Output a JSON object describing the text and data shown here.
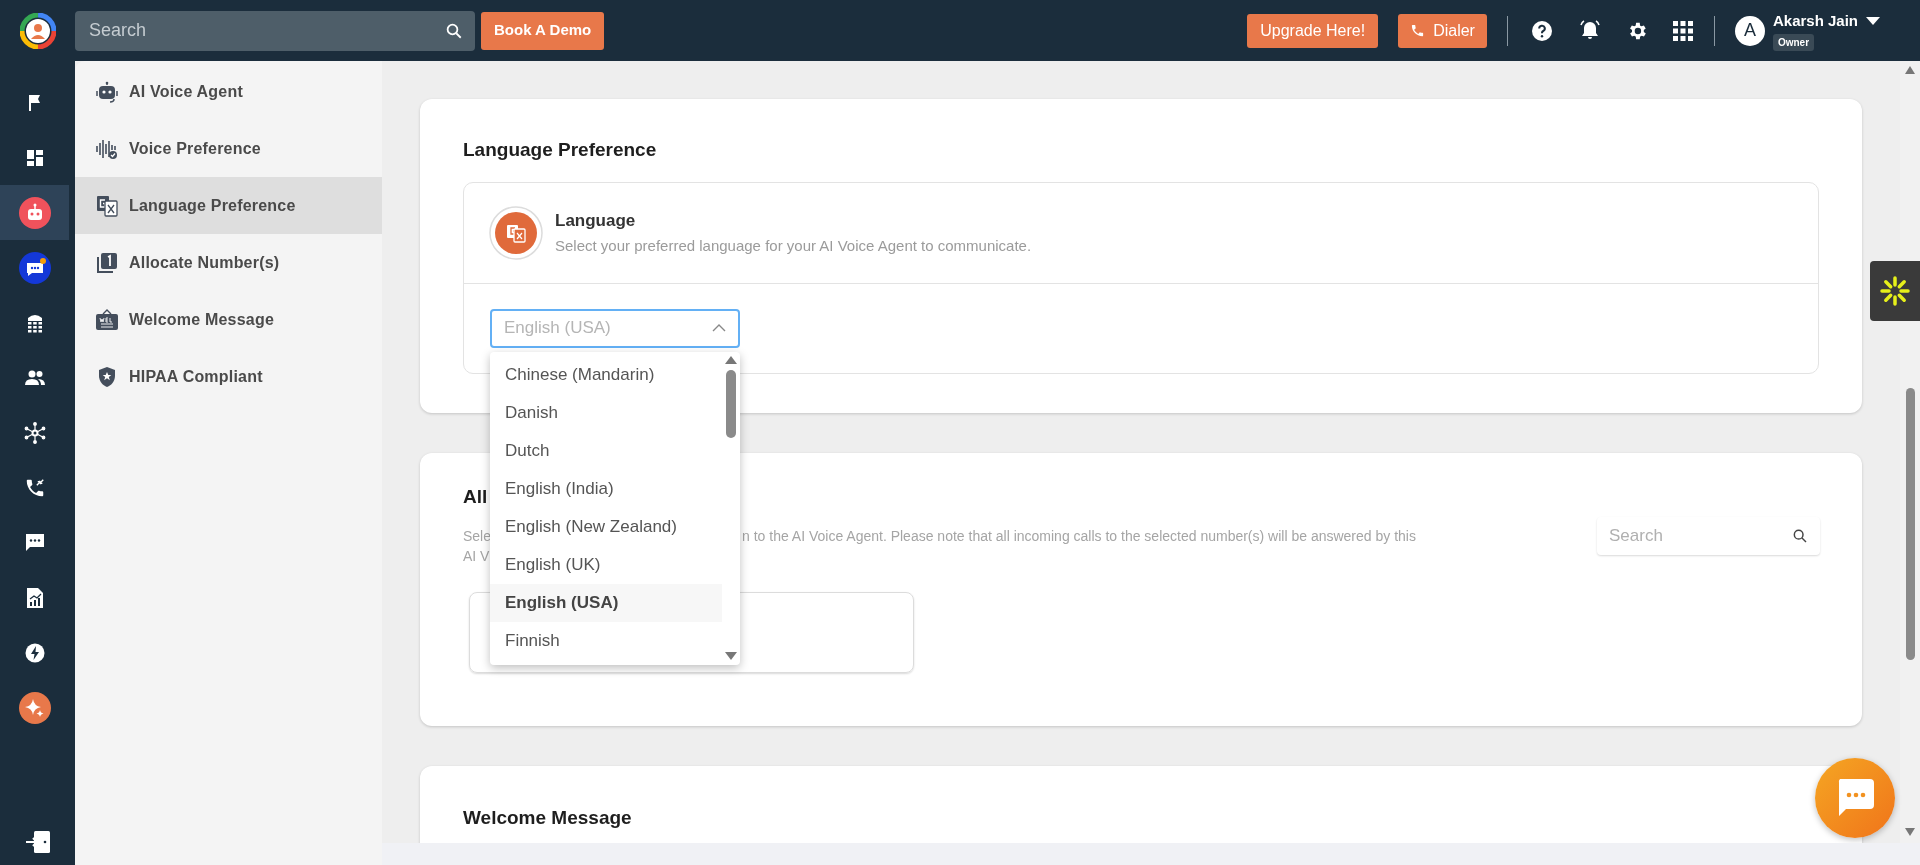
{
  "top_bar": {
    "search": {
      "placeholder": "Search"
    },
    "demo_button": "Book A Demo",
    "upgrade_button": "Upgrade Here!",
    "dialer_button": "Dialer",
    "user": {
      "avatar_letter": "A",
      "name": "Akarsh Jain",
      "role": "Owner"
    }
  },
  "rail": [
    {
      "kind": "flag",
      "selected": false
    },
    {
      "kind": "dashboard",
      "selected": false
    },
    {
      "kind": "robot",
      "selected": true
    },
    {
      "kind": "chatbot",
      "selected": false
    },
    {
      "kind": "dialpad",
      "selected": false
    },
    {
      "kind": "contacts",
      "selected": false
    },
    {
      "kind": "network",
      "selected": false
    },
    {
      "kind": "transfer",
      "selected": false
    },
    {
      "kind": "message",
      "selected": false
    },
    {
      "kind": "report",
      "selected": false
    },
    {
      "kind": "bolt",
      "selected": false
    },
    {
      "kind": "sparkle",
      "selected": false
    }
  ],
  "settings_nav": [
    {
      "label": "AI Voice Agent",
      "kind": "robot",
      "selected": false
    },
    {
      "label": "Voice Preference",
      "kind": "voice",
      "selected": false
    },
    {
      "label": "Language Preference",
      "kind": "translate",
      "selected": true
    },
    {
      "label": "Allocate Number(s)",
      "kind": "number",
      "selected": false
    },
    {
      "label": "Welcome Message",
      "kind": "welcome",
      "selected": false
    },
    {
      "label": "HIPAA Compliant",
      "kind": "shield",
      "selected": false
    }
  ],
  "language_card": {
    "title": "Language Preference",
    "setting": {
      "label": "Language",
      "description": "Select your preferred language for your AI Voice Agent to communicate."
    },
    "select": {
      "value": "English (USA)",
      "expanded": true
    },
    "options": [
      {
        "label": "Chinese (Mandarin)",
        "selected": false
      },
      {
        "label": "Danish",
        "selected": false
      },
      {
        "label": "Dutch",
        "selected": false
      },
      {
        "label": "English (India)",
        "selected": false
      },
      {
        "label": "English (New Zealand)",
        "selected": false
      },
      {
        "label": "English (UK)",
        "selected": false
      },
      {
        "label": "English (USA)",
        "selected": true
      },
      {
        "label": "Finnish",
        "selected": false
      }
    ]
  },
  "allocate_card": {
    "title": "All",
    "description_parts": [
      "Sele",
      "n to the AI Voice Agent. Please note that all incoming calls to the selected number(s) will be answered by this",
      "AI V"
    ],
    "search": {
      "placeholder": "Search"
    }
  },
  "welcome_card": {
    "title": "Welcome Message"
  }
}
